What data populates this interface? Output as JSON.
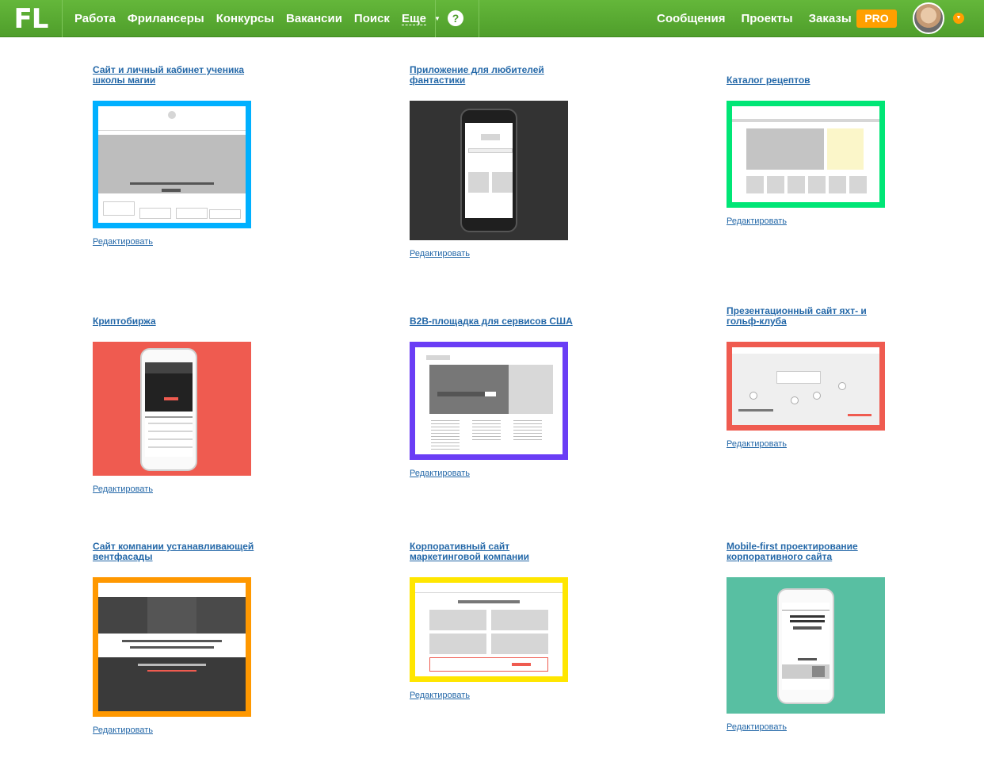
{
  "header": {
    "logo": "FL",
    "nav": [
      "Работа",
      "Фрилансеры",
      "Конкурсы",
      "Вакансии",
      "Поиск"
    ],
    "more": "Еще",
    "help": "?",
    "right_nav": [
      "Сообщения",
      "Проекты",
      "Заказы"
    ],
    "pro": "PRO"
  },
  "colors": {
    "brand": "#5aab33",
    "pro": "#ff9f00",
    "link": "#2468a8"
  },
  "edit_label": "Редактировать",
  "projects": [
    {
      "title": "Сайт и личный кабинет ученика школы магии",
      "color": "#00b0ff"
    },
    {
      "title": "Приложение для любителей фантастики",
      "color": "#333333"
    },
    {
      "title": "Каталог рецептов",
      "color": "#00e676"
    },
    {
      "title": "Криптобиржа",
      "color": "#ef5b50"
    },
    {
      "title": "B2B-площадка для сервисов США",
      "color": "#6a3df5"
    },
    {
      "title": "Презентационный сайт яхт- и гольф-клуба",
      "color": "#ef5b50"
    },
    {
      "title": "Сайт компании устанавливающей вентфасады",
      "color": "#ff9800"
    },
    {
      "title": "Корпоративный сайт маркетинговой компании",
      "color": "#ffe600"
    },
    {
      "title": "Mobile-first проектирование корпоративного сайта",
      "color": "#58bfa2"
    }
  ]
}
